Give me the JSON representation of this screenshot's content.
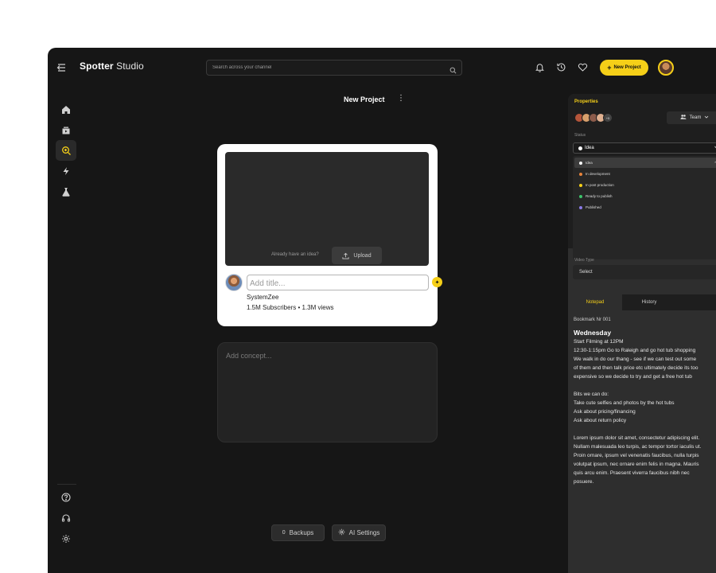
{
  "brand": {
    "name_bold": "Spotter",
    "name_light": "Studio"
  },
  "search": {
    "placeholder": "Search across your channel"
  },
  "header": {
    "new_project_label": "New Project"
  },
  "page": {
    "title": "New Project"
  },
  "upload_card": {
    "idea_prompt": "Already have an idea?",
    "upload_label": "Upload",
    "title_placeholder": "Add title...",
    "channel_name": "SystemZee",
    "channel_stats": "1.5M Subscribers • 1.3M views"
  },
  "concept": {
    "placeholder": "Add concept..."
  },
  "footer": {
    "backups_count": "0",
    "backups_label": "Backups",
    "ai_settings_label": "AI Settings"
  },
  "properties": {
    "title": "Properties",
    "team_more": "+5",
    "team_label": "Team",
    "status_label": "Status",
    "status_value": "Idea",
    "status_options": [
      {
        "label": "Idea",
        "color": "#ffffff"
      },
      {
        "label": "In development",
        "color": "#e8833a"
      },
      {
        "label": "In post production",
        "color": "#f5cf18"
      },
      {
        "label": "Ready to publish",
        "color": "#3cc46a"
      },
      {
        "label": "Published",
        "color": "#8a7ae8"
      }
    ],
    "video_type_label": "Video Type",
    "video_type_value": "Select"
  },
  "tabs": {
    "notepad": "Notepad",
    "history": "History"
  },
  "notepad": {
    "bookmark": "Bookmark Nr 001",
    "heading": "Wednesday",
    "lines_a": [
      "Start Filming at 12PM",
      "12:30-1:15pm Go to Raleigh and go hot tub shopping",
      "We walk in do our thang - see if we can test out some",
      "of them and then talk price etc ultimately decide its too",
      "expensive so we decide to try and get a free hot tub"
    ],
    "lines_b": [
      "Bits we can do:",
      "Take cute selfies and photos by the hot tubs",
      "Ask about pricing/financing",
      "Ask about return policy"
    ],
    "lines_c": [
      "Lorem ipsum dolor sit amet, consectetur adipiscing elit.",
      "Nullam malesuada leo turpis, ac tempor tortor iaculis ut.",
      "Proin ornare, ipsum vel venenatis faucibus, nulla turpis",
      "volutpat ipsum, nec ornare enim felis in magna. Mauris",
      "quis arcu enim. Praesent viverra faucibus nibh nec",
      "posuere."
    ]
  },
  "colors": {
    "accent": "#f5cf18",
    "background": "#161616",
    "panel": "#2e2e2e"
  }
}
